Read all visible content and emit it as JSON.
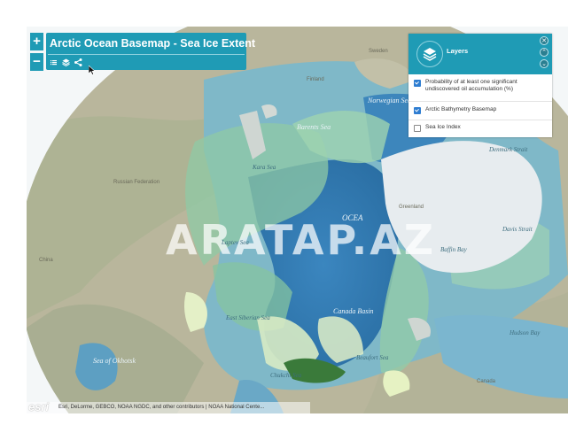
{
  "app": {
    "title": "Arctic Ocean Basemap - Sea Ice Extent",
    "watermark": "ARATAP.AZ"
  },
  "zoom": {
    "in_label": "+",
    "out_label": "−"
  },
  "toolbar": {
    "icons": [
      "list-icon",
      "layers-icon",
      "share-icon"
    ]
  },
  "layers_panel": {
    "title": "Layers",
    "close_label": "✕",
    "up_label": "⌃",
    "down_label": "⌄",
    "items": [
      {
        "label": "Probability of at least one significant undiscovered oil accumulation (%)",
        "checked": true
      },
      {
        "label": "Arctic Bathymetry Basemap",
        "checked": true
      },
      {
        "label": "Sea Ice Index",
        "checked": false
      }
    ]
  },
  "map_labels": {
    "barents_sea": "Barents Sea",
    "norwegian_sea": "Norwegian Sea",
    "kara_sea": "Kara Sea",
    "russian_federation": "Russian Federation",
    "laptev_sea": "Laptev Sea",
    "east_siberian_sea": "East Siberian Sea",
    "greenland": "Greenland",
    "baffin_bay": "Baffin Bay",
    "davis_strait": "Davis Strait",
    "denmark_strait": "Denmark Strait",
    "hudson_bay": "Hudson Bay",
    "canada": "Canada",
    "beaufort_sea": "Beaufort Sea",
    "chukchi_sea": "Chukchi Sea",
    "sea_of_okhotsk": "Sea of Okhotsk",
    "china": "China",
    "canada_basin": "Canada Basin",
    "finland": "Finland",
    "sweden": "Sweden",
    "arctic_ocean": "OCEA"
  },
  "attribution": {
    "logo": "esri",
    "text": "Esri, DeLorme, GEBCO, NOAA NGDC, and other contributors | NOAA National Cente..."
  },
  "colors": {
    "accent": "#1f9bb5",
    "ocean_deep": "#2f7fb7",
    "ocean_shelf": "#7fb8c8",
    "land": "#b5b49a",
    "oil_probability": "#8fc9a6",
    "high_probability": "#3a7a3a",
    "ice": "#e7ecef"
  }
}
